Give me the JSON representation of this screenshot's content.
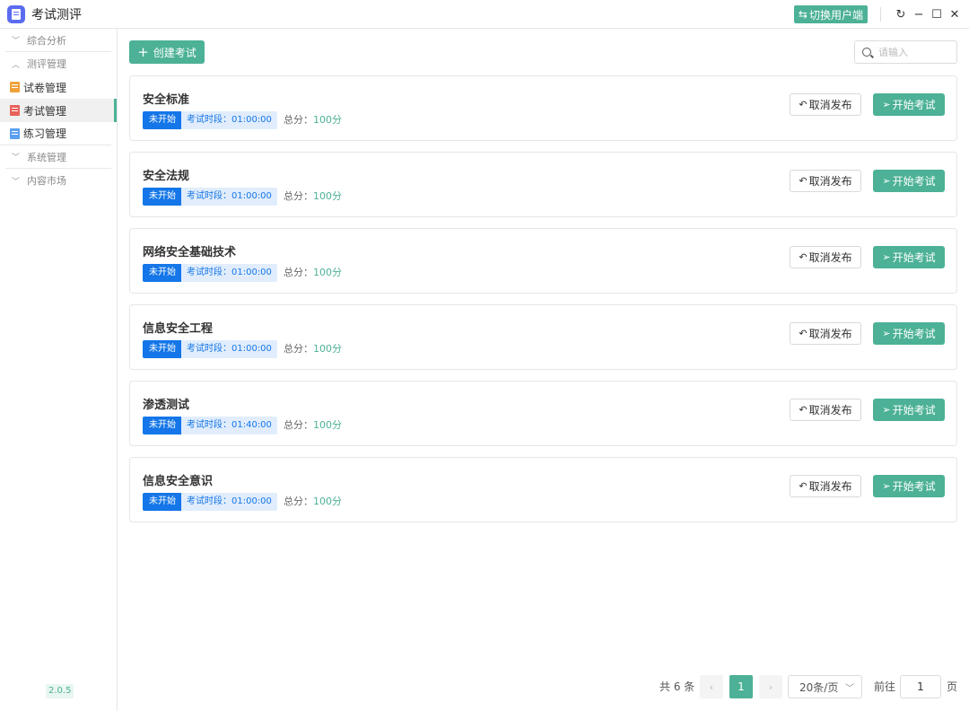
{
  "app": {
    "title": "考试测评",
    "switch_label": "切换用户端",
    "version": "2.0.5"
  },
  "sidebar": {
    "groups": [
      {
        "label": "综合分析",
        "chevron": "chevron-down-icon"
      },
      {
        "label": "测评管理",
        "chevron": "chevron-up-icon"
      }
    ],
    "items": [
      {
        "label": "试卷管理",
        "icon": "paper-icon",
        "color": "#f0a23a"
      },
      {
        "label": "考试管理",
        "icon": "exam-icon",
        "color": "#e8615a"
      },
      {
        "label": "练习管理",
        "icon": "practice-icon",
        "color": "#5b9ff0"
      }
    ],
    "groups2": [
      {
        "label": "系统管理"
      },
      {
        "label": "内容市场"
      }
    ]
  },
  "toolbar": {
    "create_label": "创建考试",
    "search_placeholder": "请输入"
  },
  "exams": [
    {
      "title": "安全标准",
      "status": "未开始",
      "time": "考试时段：01:00:00",
      "total_label": "总分：",
      "total_value": "100分",
      "cancel_label": "取消发布",
      "start_label": "开始考试"
    },
    {
      "title": "安全法规",
      "status": "未开始",
      "time": "考试时段：01:00:00",
      "total_label": "总分：",
      "total_value": "100分",
      "cancel_label": "取消发布",
      "start_label": "开始考试"
    },
    {
      "title": "网络安全基础技术",
      "status": "未开始",
      "time": "考试时段：01:00:00",
      "total_label": "总分：",
      "total_value": "100分",
      "cancel_label": "取消发布",
      "start_label": "开始考试"
    },
    {
      "title": "信息安全工程",
      "status": "未开始",
      "time": "考试时段：01:00:00",
      "total_label": "总分：",
      "total_value": "100分",
      "cancel_label": "取消发布",
      "start_label": "开始考试"
    },
    {
      "title": "渗透测试",
      "status": "未开始",
      "time": "考试时段：01:40:00",
      "total_label": "总分：",
      "total_value": "100分",
      "cancel_label": "取消发布",
      "start_label": "开始考试"
    },
    {
      "title": "信息安全意识",
      "status": "未开始",
      "time": "考试时段：01:00:00",
      "total_label": "总分：",
      "total_value": "100分",
      "cancel_label": "取消发布",
      "start_label": "开始考试"
    }
  ],
  "pagination": {
    "total": "共 6 条",
    "current": "1",
    "page_size": "20条/页",
    "goto_label": "前往",
    "goto_value": "1",
    "page_label": "页"
  },
  "colors": {
    "accent": "#4cb196",
    "status_blue": "#1476e8"
  }
}
